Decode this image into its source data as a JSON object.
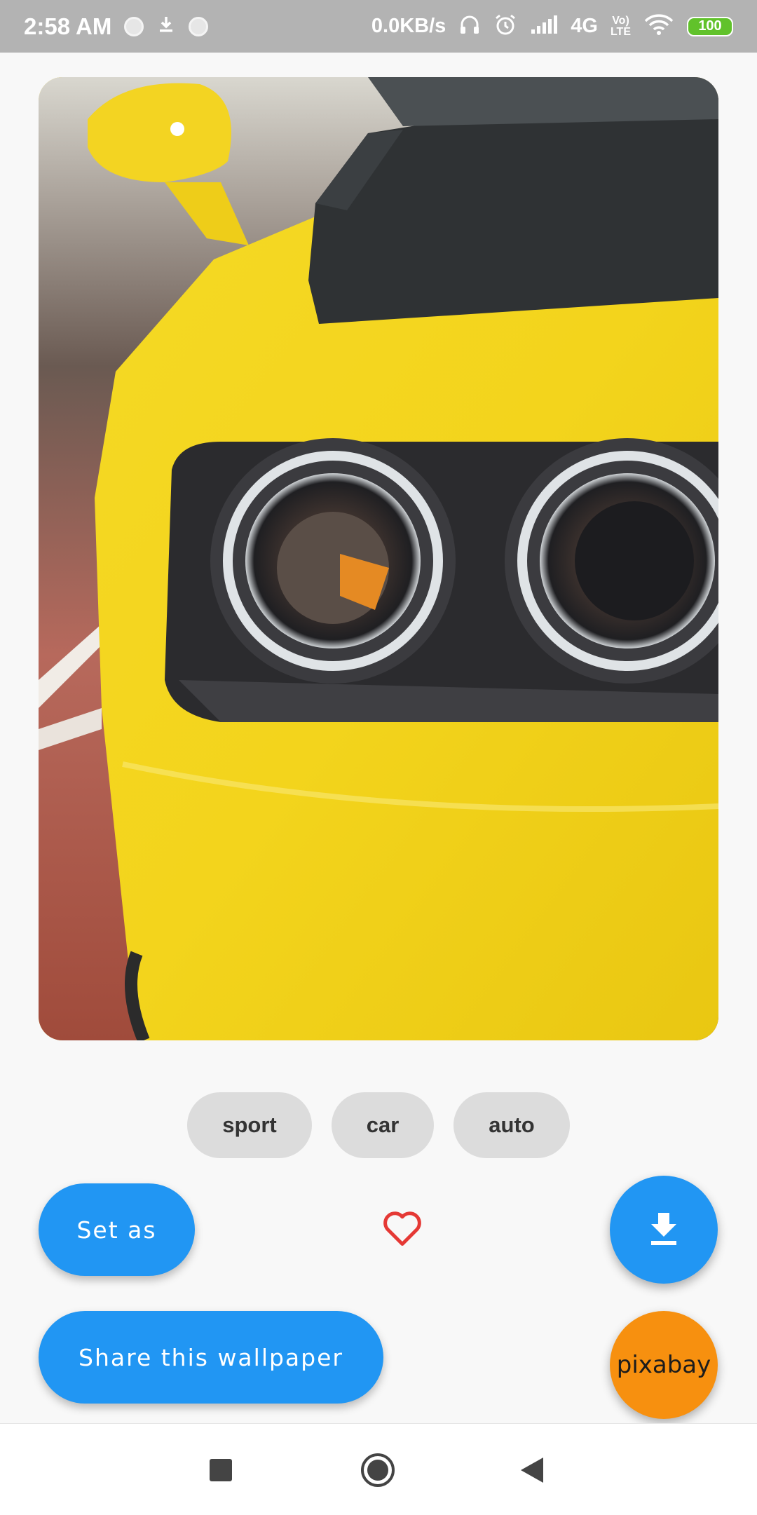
{
  "status_bar": {
    "time": "2:58 AM",
    "net_speed": "0.0KB/s",
    "network": "4G",
    "volte_top": "Vo)",
    "volte_bottom": "LTE",
    "battery": "100",
    "icons": [
      "notification-dot-icon",
      "download-icon",
      "notification-dot-icon",
      "headphones-icon",
      "alarm-icon",
      "signal-icon",
      "wifi-icon",
      "battery-icon"
    ]
  },
  "wallpaper": {
    "subject_icon": "car-headlight-image"
  },
  "tags": [
    "sport",
    "car",
    "auto"
  ],
  "actions": {
    "set_as_label": "Set as",
    "share_label": "Share this wallpaper",
    "favorite_icon": "heart-outline-icon",
    "download_icon": "download-icon",
    "source_logo": "pixabay"
  },
  "colors": {
    "accent": "#2196f3",
    "pixabay": "#f7900f",
    "heart": "#e53935",
    "tag_bg": "#dcdcdc"
  },
  "nav_bar": {
    "icons": [
      "recents-square-icon",
      "home-circle-icon",
      "back-triangle-icon"
    ]
  }
}
